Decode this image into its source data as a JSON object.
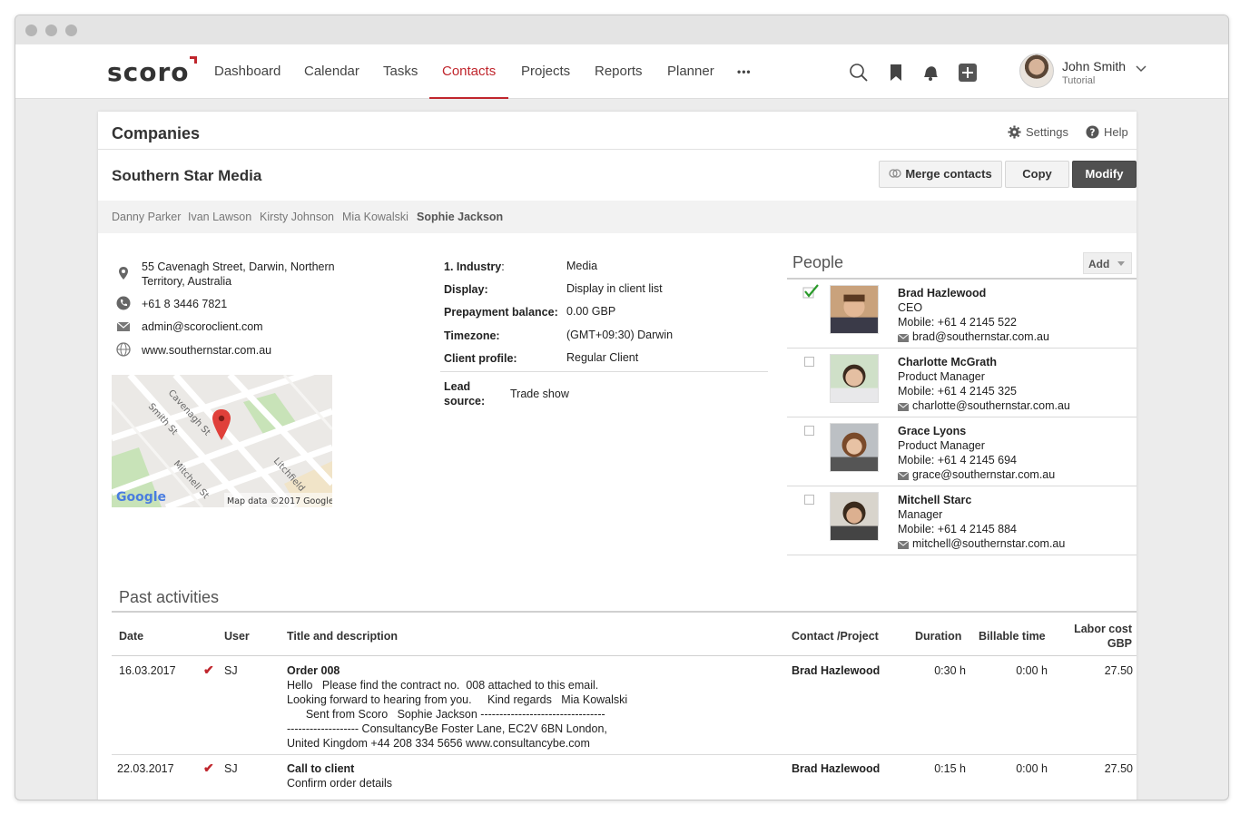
{
  "nav": {
    "logo": "scoro",
    "items": [
      "Dashboard",
      "Calendar",
      "Tasks",
      "Contacts",
      "Projects",
      "Reports",
      "Planner"
    ],
    "more": "•••",
    "active": "Contacts"
  },
  "user": {
    "name": "John Smith",
    "role": "Tutorial"
  },
  "header": {
    "section": "Companies",
    "settings": "Settings",
    "help": "Help"
  },
  "company": {
    "name": "Southern Star Media",
    "buttons": {
      "merge": "Merge contacts",
      "copy": "Copy",
      "modify": "Modify"
    },
    "contact_tabs": [
      "Danny Parker",
      "Ivan Lawson",
      "Kirsty Johnson",
      "Mia Kowalski",
      "Sophie Jackson"
    ],
    "selected_tab": "Sophie Jackson",
    "address_line1": "55 Cavenagh Street, Darwin, Northern",
    "address_line2": "Territory, Australia",
    "phone": "+61 8 3446 7821",
    "email": "admin@scoroclient.com",
    "website": "www.southernstar.com.au",
    "map": {
      "streets": [
        "Cavenagh St",
        "Smith St",
        "Mitchell St",
        "Litchfield"
      ],
      "brand": "Google",
      "credit": "Map data ©2017 Google"
    }
  },
  "fields": [
    {
      "label": "1. Industry",
      "suffix": ":",
      "value": "Media"
    },
    {
      "label": "Display:",
      "suffix": "",
      "value": "Display in client list"
    },
    {
      "label": "Prepayment balance:",
      "suffix": "",
      "value": "0.00 GBP"
    },
    {
      "label": "Timezone:",
      "suffix": "",
      "value": "(GMT+09:30) Darwin"
    },
    {
      "label": "Client profile:",
      "suffix": "",
      "value": "Regular Client"
    }
  ],
  "lead_source": {
    "label_line1": "Lead",
    "label_line2": "source:",
    "value": "Trade show"
  },
  "people": {
    "title": "People",
    "add": "Add",
    "list": [
      {
        "name": "Brad Hazlewood",
        "role": "CEO",
        "mobile": "Mobile: +61 4 2145 522",
        "email": "brad@southernstar.com.au",
        "checked": true
      },
      {
        "name": "Charlotte McGrath",
        "role": "Product Manager",
        "mobile": "Mobile: +61 4 2145 325",
        "email": "charlotte@southernstar.com.au",
        "checked": false
      },
      {
        "name": "Grace Lyons",
        "role": "Product Manager",
        "mobile": "Mobile: +61 4 2145 694",
        "email": "grace@southernstar.com.au",
        "checked": false
      },
      {
        "name": "Mitchell Starc",
        "role": "Manager",
        "mobile": "Mobile: +61 4 2145 884",
        "email": "mitchell@southernstar.com.au",
        "checked": false
      }
    ]
  },
  "activities": {
    "title": "Past activities",
    "columns": {
      "date": "Date",
      "user": "User",
      "title": "Title and description",
      "contact": "Contact /Project",
      "duration": "Duration",
      "billable": "Billable time",
      "labor1": "Labor cost",
      "labor2": "GBP"
    },
    "rows": [
      {
        "date": "16.03.2017",
        "user": "SJ",
        "title": "Order 008",
        "desc": [
          "Hello   Please find the contract no.  008 attached to this email.",
          "Looking forward to hearing from you.     Kind regards   Mia Kowalski",
          "      Sent from Scoro   Sophie Jackson ---------------------------------",
          "------------------- ConsultancyBe Foster Lane, EC2V 6BN London,",
          "United Kingdom +44 208 334 5656 www.consultancybe.com"
        ],
        "contact": "Brad Hazlewood",
        "duration": "0:30 h",
        "billable": "0:00 h",
        "labor": "27.50"
      },
      {
        "date": "22.03.2017",
        "user": "SJ",
        "title": "Call to client",
        "desc": [
          "Confirm order details"
        ],
        "contact": "Brad Hazlewood",
        "duration": "0:15 h",
        "billable": "0:00 h",
        "labor": "27.50"
      }
    ]
  },
  "colors": {
    "accent": "#c0262d",
    "dark_button": "#505050",
    "check_green": "#2a9a2a"
  },
  "icons": [
    "search-icon",
    "bookmark-icon",
    "bell-icon",
    "plus-icon",
    "gear-icon",
    "help-icon",
    "location-icon",
    "phone-icon",
    "mail-icon",
    "globe-icon"
  ]
}
